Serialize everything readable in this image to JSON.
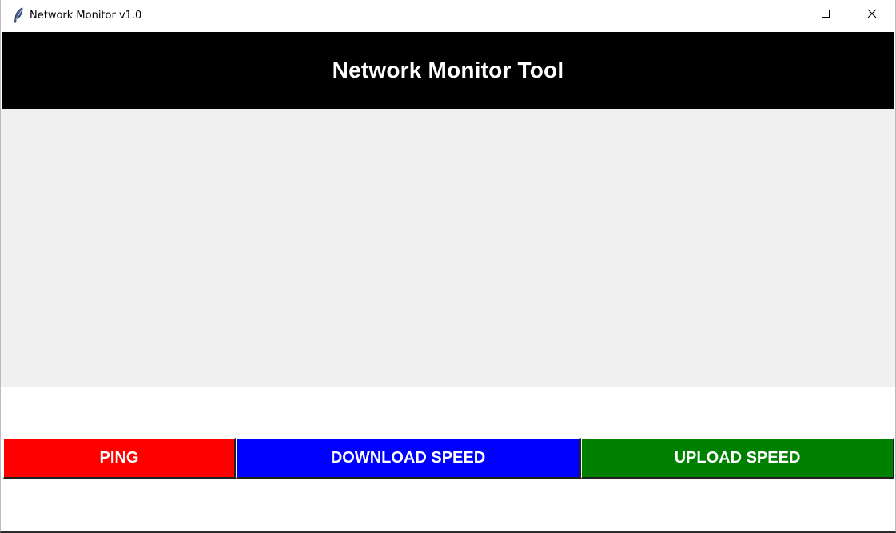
{
  "window": {
    "title": "Network Monitor v1.0",
    "icon": "feather-icon",
    "controls": [
      "minimize-icon",
      "maximize-icon",
      "close-icon"
    ]
  },
  "header": {
    "title": "Network Monitor Tool",
    "background": "#000000",
    "color": "#ffffff"
  },
  "content": {
    "background": "#f0f0f0"
  },
  "buttons": [
    {
      "label": "PING",
      "color": "#ff0000"
    },
    {
      "label": "DOWNLOAD SPEED",
      "color": "#0000ff"
    },
    {
      "label": "UPLOAD SPEED",
      "color": "#008000"
    }
  ]
}
